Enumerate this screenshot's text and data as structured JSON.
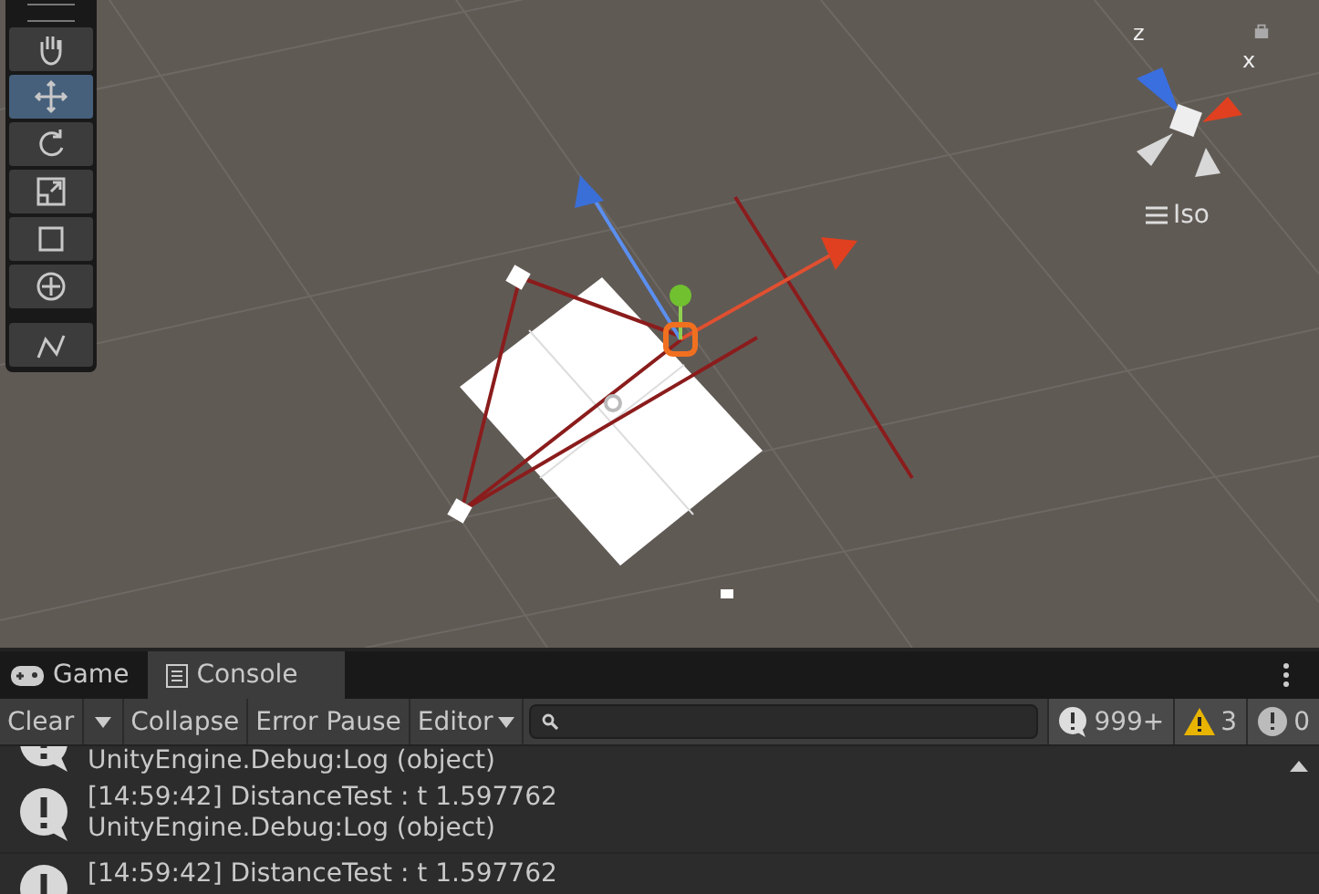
{
  "scene": {
    "tools": [
      {
        "kind": "hand",
        "selected": false
      },
      {
        "kind": "move",
        "selected": true
      },
      {
        "kind": "rotate",
        "selected": false
      },
      {
        "kind": "scale",
        "selected": false
      },
      {
        "kind": "rect",
        "selected": false
      },
      {
        "kind": "transform",
        "selected": false
      },
      {
        "kind": "custom",
        "selected": false
      }
    ],
    "gizmo": {
      "z_label": "z",
      "x_label": "x"
    },
    "projection": "Iso"
  },
  "tabs": [
    {
      "label": "Game",
      "kind": "game",
      "selected": false
    },
    {
      "label": "Console",
      "kind": "console",
      "selected": true
    }
  ],
  "toolbar": {
    "buttons": [
      "Clear",
      "Collapse",
      "Error Pause",
      "Editor"
    ],
    "counters": [
      {
        "kind": "log",
        "count": "999+"
      },
      {
        "kind": "warning",
        "count": "3"
      },
      {
        "kind": "error",
        "count": "0"
      }
    ]
  },
  "log": [
    {
      "lines": [
        "UnityEngine.Debug:Log (object)"
      ]
    },
    {
      "lines": [
        "[14:59:42] DistanceTest : t 1.597762",
        "UnityEngine.Debug:Log (object)"
      ]
    },
    {
      "lines": [
        "[14:59:42] DistanceTest : t 1.597762"
      ]
    }
  ]
}
